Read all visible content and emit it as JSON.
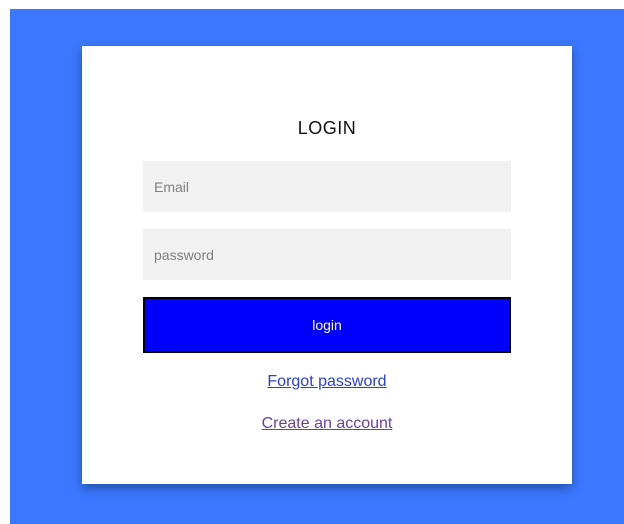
{
  "login_form": {
    "title": "LOGIN",
    "email_placeholder": "Email",
    "password_placeholder": "password",
    "submit_label": "login",
    "forgot_password_label": "Forgot password",
    "create_account_label": "Create an account"
  },
  "colors": {
    "background": "#3a78ff",
    "card": "#ffffff",
    "input_bg": "#f1f1f1",
    "button_bg": "#0000ff",
    "button_border": "#000000",
    "button_text": "#ffffff",
    "forgot_link": "#2a3fd6",
    "create_link": "#6b3fa0"
  }
}
